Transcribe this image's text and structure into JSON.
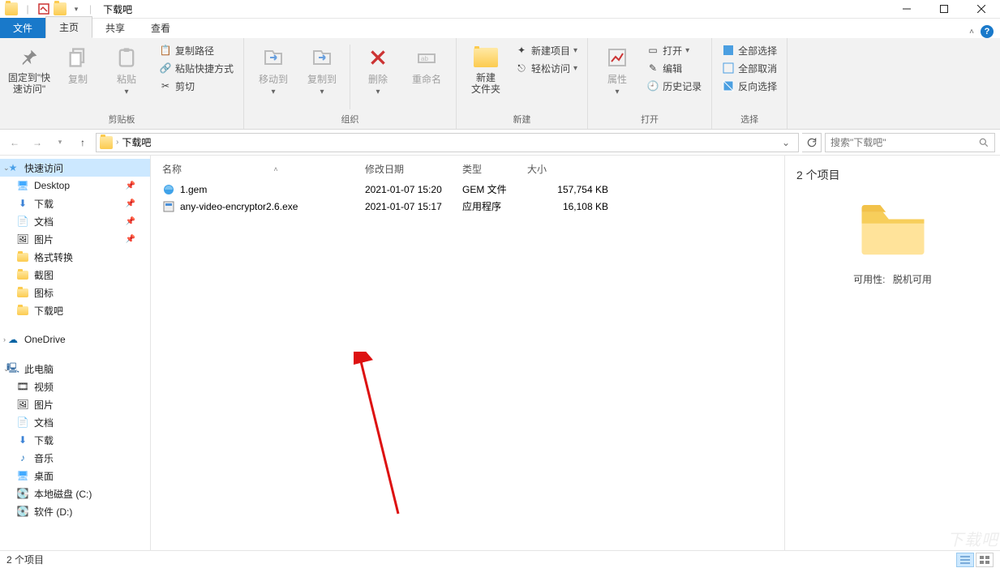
{
  "window": {
    "title": "下载吧"
  },
  "tabs": {
    "file": "文件",
    "home": "主页",
    "share": "共享",
    "view": "查看"
  },
  "ribbon": {
    "pin": "固定到\"快\n速访问\"",
    "copy": "复制",
    "paste": "粘贴",
    "copy_path": "复制路径",
    "paste_shortcut": "粘贴快捷方式",
    "cut": "剪切",
    "group_clip": "剪贴板",
    "move_to": "移动到",
    "copy_to": "复制到",
    "delete": "删除",
    "rename": "重命名",
    "group_org": "组织",
    "new_folder": "新建\n文件夹",
    "new_item": "新建项目",
    "easy_access": "轻松访问",
    "group_new": "新建",
    "properties": "属性",
    "open": "打开",
    "edit": "编辑",
    "history": "历史记录",
    "group_open": "打开",
    "select_all": "全部选择",
    "select_none": "全部取消",
    "invert": "反向选择",
    "group_select": "选择"
  },
  "address": {
    "crumb": "下载吧"
  },
  "search": {
    "placeholder": "搜索\"下载吧\""
  },
  "nav": {
    "quick": "快速访问",
    "desktop": "Desktop",
    "downloads": "下载",
    "documents": "文档",
    "pictures": "图片",
    "format": "格式转换",
    "screenshot": "截图",
    "icons": "图标",
    "xzb": "下载吧",
    "onedrive": "OneDrive",
    "thispc": "此电脑",
    "videos": "视频",
    "pictures2": "图片",
    "documents2": "文档",
    "downloads2": "下载",
    "music": "音乐",
    "desktop2": "桌面",
    "cdrive": "本地磁盘 (C:)",
    "ddrive": "软件 (D:)"
  },
  "columns": {
    "name": "名称",
    "date": "修改日期",
    "type": "类型",
    "size": "大小"
  },
  "files": [
    {
      "name": "1.gem",
      "date": "2021-01-07 15:20",
      "type": "GEM 文件",
      "size": "157,754 KB"
    },
    {
      "name": "any-video-encryptor2.6.exe",
      "date": "2021-01-07 15:17",
      "type": "应用程序",
      "size": "16,108 KB"
    }
  ],
  "preview": {
    "count": "2 个项目",
    "availability_label": "可用性:",
    "availability_value": "脱机可用"
  },
  "status": {
    "text": "2 个项目"
  }
}
